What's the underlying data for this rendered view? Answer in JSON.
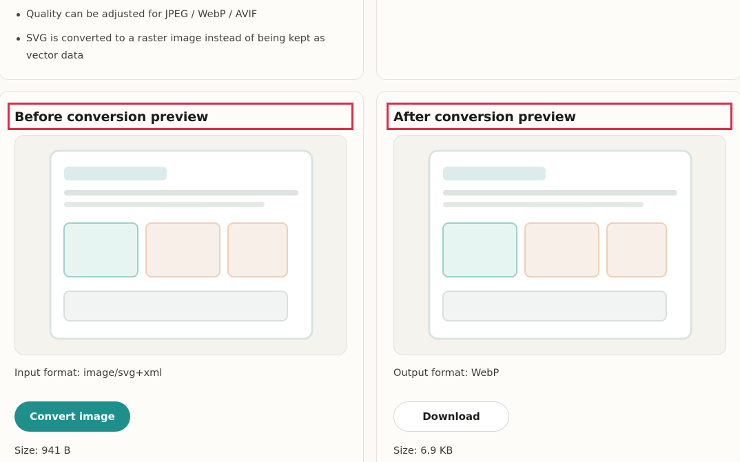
{
  "notes": {
    "items": [
      "Quality can be adjusted for JPEG / WebP / AVIF",
      "SVG is converted to a raster image instead of being kept as vector data"
    ]
  },
  "before": {
    "heading": "Before conversion preview",
    "format_text": "Input format: image/svg+xml",
    "button_label": "Convert image",
    "size_text": "Size: 941 B"
  },
  "after": {
    "heading": "After conversion preview",
    "format_text": "Output format: WebP",
    "button_label": "Download",
    "size_text": "Size: 6.9 KB"
  },
  "colors": {
    "accent": "#1f8f8c",
    "highlight_border": "#dc2a4c",
    "page_background": "#fbfaf6"
  }
}
